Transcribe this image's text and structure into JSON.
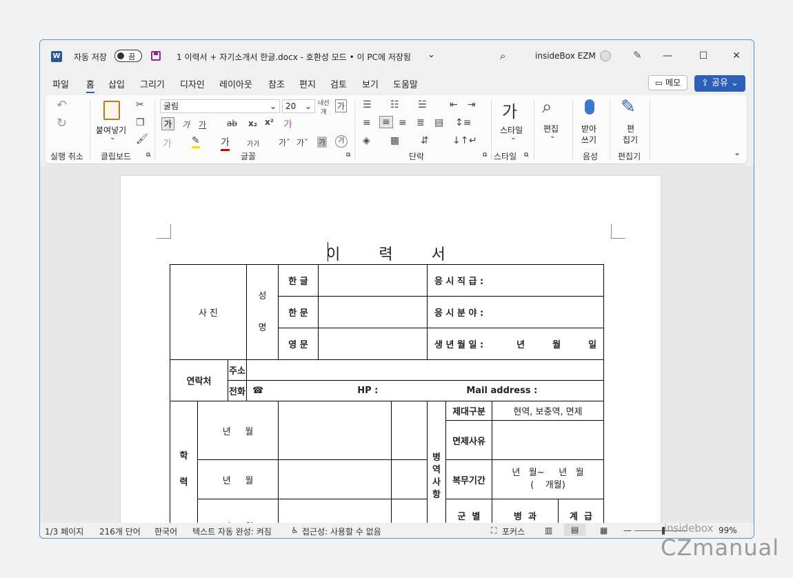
{
  "titlebar": {
    "app_icon": "word-icon",
    "autosave_label": "자동 저장",
    "autosave_state": "끔",
    "doc_title": "1 이력서 + 자기소개서 한글.docx  -  호환성 모드 • 이 PC에 저장됨",
    "user_name": "insideBox EZM",
    "minimize": "—",
    "maximize": "☐",
    "close": "✕"
  },
  "menu": {
    "items": [
      "파일",
      "홈",
      "삽입",
      "그리기",
      "디자인",
      "레이아웃",
      "참조",
      "편지",
      "검토",
      "보기",
      "도움말"
    ],
    "memo": "메모",
    "share": "공유"
  },
  "ribbon": {
    "undo_group": "실행 취소",
    "clipboard_group": "클립보드",
    "paste_label": "붙여넣기",
    "font_group": "글꼴",
    "font_name": "굴림",
    "font_size": "20",
    "paragraph_group": "단락",
    "style_group": "스타일",
    "style_label": "스타일",
    "edit_label": "편집",
    "voice_group": "음성",
    "dictate_label1": "받아",
    "dictate_label2": "쓰기",
    "editor_group": "편집기",
    "editor_label1": "편",
    "editor_label2": "집기"
  },
  "document": {
    "title": "이  력  서",
    "photo": "사  진",
    "name_label1": "성",
    "name_label2": "명",
    "hangul": "한 글",
    "hanja": "한 문",
    "english": "영 문",
    "position": "응 시 직 급 :",
    "field": "응 시 분 야 :",
    "birth": "생 년 월 일 :",
    "birth_year": "년",
    "birth_month": "월",
    "birth_day": "일",
    "contact": "연락처",
    "address": "주소",
    "phone": "전화",
    "phone_icon": "☎",
    "hp": "HP :",
    "mail": "Mail address :",
    "edu_label1": "학",
    "edu_label2": "력",
    "year_month": "년     월",
    "military_label": "병\n역\n사\n항",
    "discharge_type": "제대구분",
    "discharge_value": "현역, 보충역, 면제",
    "exempt_reason": "면제사유",
    "service_period": "복무기간",
    "service_value1": "년   월~     년   월",
    "service_value2": "(    개월)",
    "branch": "군  별",
    "arm": "병  과",
    "rank": "계  급"
  },
  "status": {
    "page": "1/3 페이지",
    "words": "216개 단어",
    "lang": "한국어",
    "autocomplete": "텍스트 자동 완성: 켜짐",
    "accessibility": "접근성: 사용할 수 없음",
    "focus": "포커스",
    "zoom": "99%"
  },
  "watermark": {
    "small": "insidebox",
    "big": "CZmanual"
  }
}
